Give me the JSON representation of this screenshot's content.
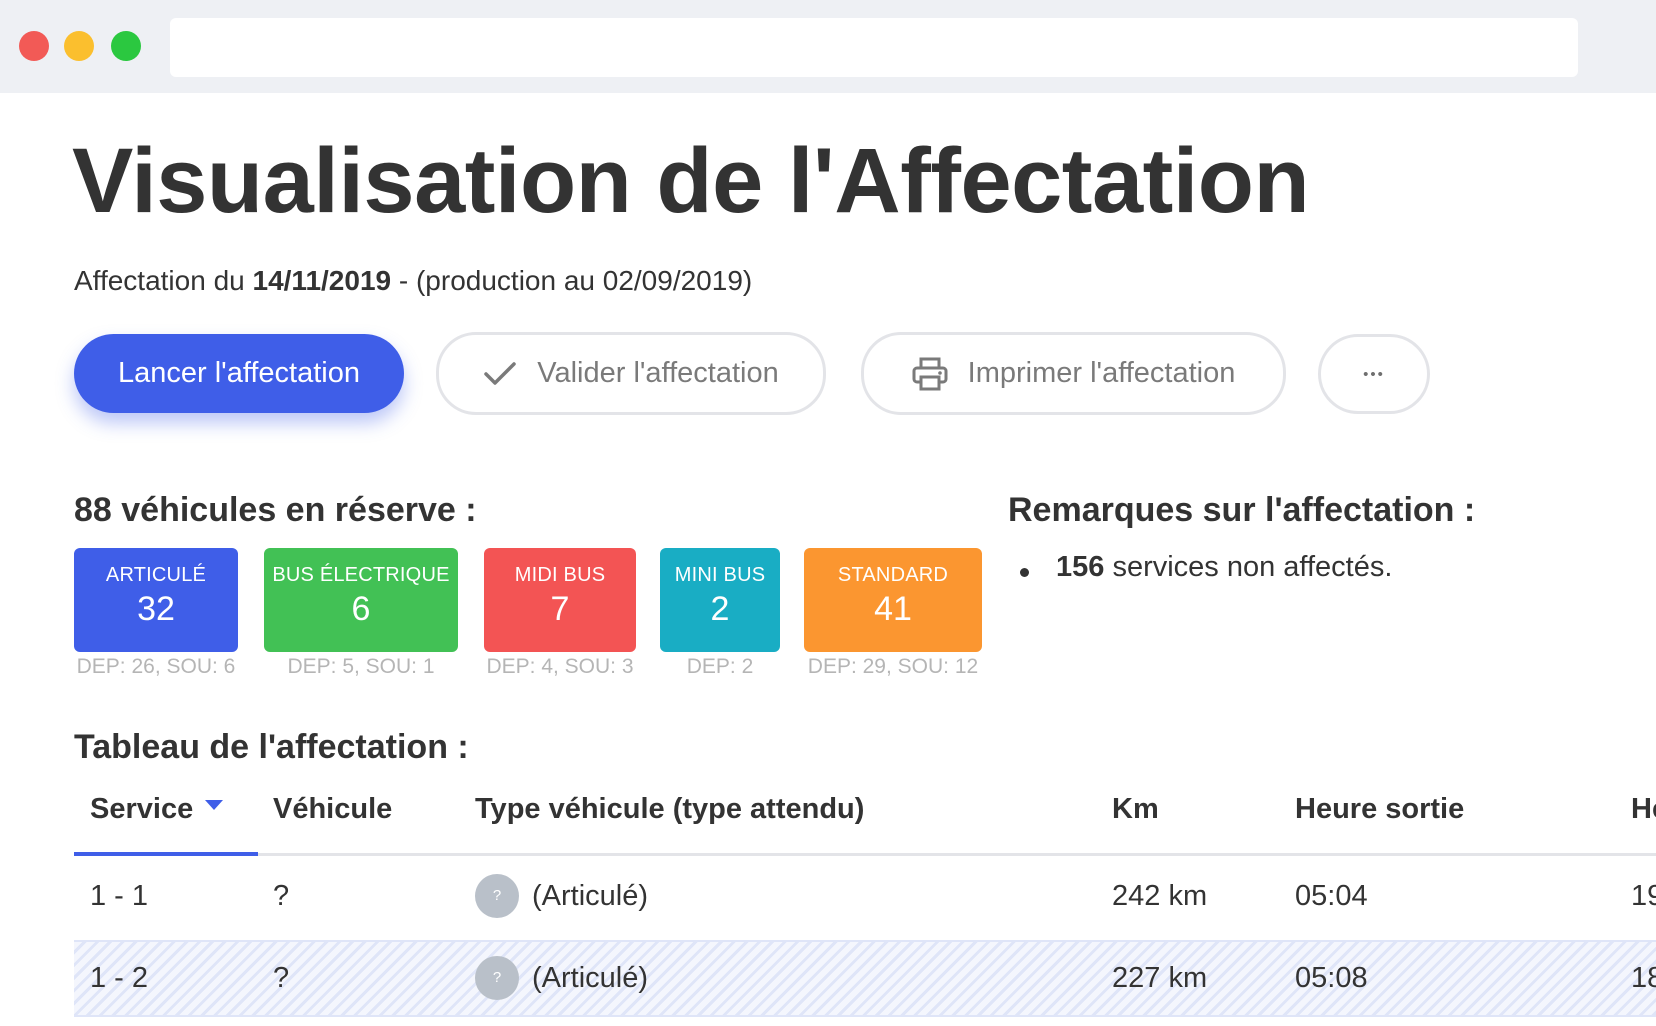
{
  "page": {
    "title": "Visualisation de l'Affectation",
    "subtitle_prefix": "Affectation du ",
    "subtitle_date": "14/11/2019",
    "subtitle_suffix": " - (production au 02/09/2019)"
  },
  "actions": {
    "launch": "Lancer l'affectation",
    "validate": "Valider l'affectation",
    "print": "Imprimer l'affectation",
    "more": "•••"
  },
  "reserve": {
    "title": "88 véhicules en réserve :",
    "cards": [
      {
        "label": "ARTICULÉ",
        "count": "32",
        "detail": "DEP: 26, SOU: 6",
        "color": "#3f5ee8"
      },
      {
        "label": "BUS ÉLECTRIQUE",
        "count": "6",
        "detail": "DEP: 5, SOU: 1",
        "color": "#42c155"
      },
      {
        "label": "MIDI BUS",
        "count": "7",
        "detail": "DEP: 4, SOU: 3",
        "color": "#f35454"
      },
      {
        "label": "MINI BUS",
        "count": "2",
        "detail": "DEP: 2",
        "color": "#19adc4"
      },
      {
        "label": "STANDARD",
        "count": "41",
        "detail": "DEP: 29, SOU: 12",
        "color": "#fb9630"
      }
    ]
  },
  "remarks": {
    "title": "Remarques sur l'affectation :",
    "items": [
      {
        "count": "156",
        "text": " services non affectés."
      }
    ]
  },
  "table": {
    "title": "Tableau de l'affectation :",
    "headers": [
      "Service",
      "Véhicule",
      "Type véhicule (type attendu)",
      "Km",
      "Heure sortie",
      "He"
    ],
    "rows": [
      {
        "service": "1 - 1",
        "vehicle": "?",
        "badge": "?",
        "type": "(Articulé)",
        "km": "242 km",
        "exit": "05:04",
        "next": "19"
      },
      {
        "service": "1 - 2",
        "vehicle": "?",
        "badge": "?",
        "type": "(Articulé)",
        "km": "227 km",
        "exit": "05:08",
        "next": "18"
      }
    ]
  },
  "colors": {
    "accent": "#3f5ee8",
    "titlebar": "#eef0f4"
  }
}
